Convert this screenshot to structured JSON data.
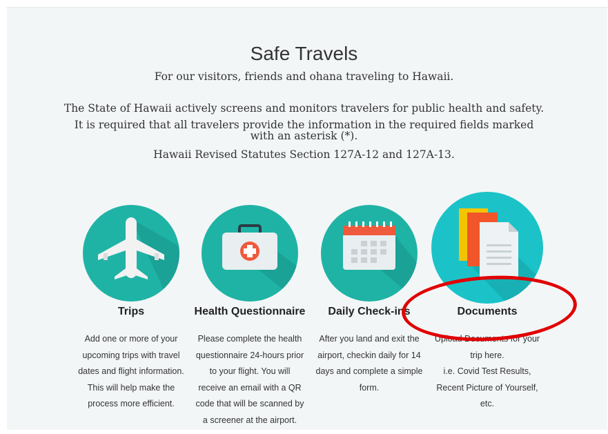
{
  "header": {
    "title": "Safe Travels",
    "subtitle": "For our visitors, friends and ohana traveling to Hawaii."
  },
  "intro": {
    "line1": "The State of Hawaii actively screens and monitors travelers for public health and safety.",
    "line2": "It is required that all travelers provide the information in the required fields marked",
    "line3": "with an asterisk (*).",
    "line4": "Hawaii Revised Statutes Section 127A-12 and 127A-13."
  },
  "cards": [
    {
      "title": "Trips",
      "icon": "airplane-icon",
      "desc": [
        "Add one or more of your",
        "upcoming trips with travel",
        "dates and flight information.",
        "This will help make the",
        "process more efficient."
      ]
    },
    {
      "title": "Health Questionnaire",
      "icon": "medical-kit-icon",
      "desc": [
        "Please complete the health",
        "questionnaire 24-hours prior",
        "to your flight. You will",
        "receive an email with a QR",
        "code that will be scanned by",
        "a screener at the airport."
      ]
    },
    {
      "title": "Daily Check-ins",
      "icon": "calendar-icon",
      "desc": [
        "After you land and exit the",
        "airport, checkin daily for 14",
        "days and complete a simple",
        "form."
      ]
    },
    {
      "title": "Documents",
      "icon": "documents-icon",
      "desc": [
        "Upload Documents for your",
        "trip here.",
        "i.e. Covid Test Results,",
        "Recent Picture of Yourself,",
        "etc."
      ]
    }
  ],
  "colors": {
    "circle": "#1fb3a5",
    "highlight": "#e10000"
  }
}
